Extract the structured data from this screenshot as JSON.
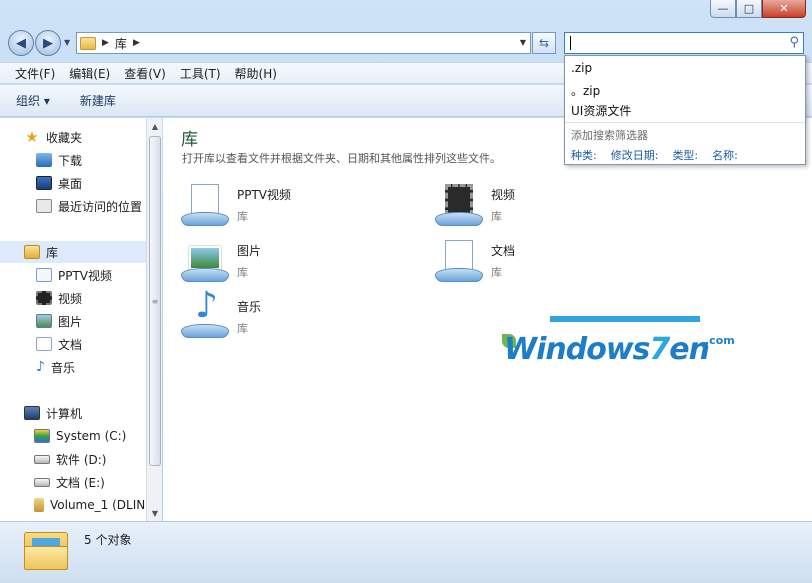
{
  "window": {
    "caption_buttons": [
      "minimize",
      "maximize",
      "close"
    ]
  },
  "address_bar": {
    "crumbs": [
      "库"
    ],
    "search_value": ""
  },
  "search_popup": {
    "history": [
      ".zip",
      "。zip",
      "UI资源文件"
    ],
    "filters_title": "添加搜索筛选器",
    "filters": [
      "种类:",
      "修改日期:",
      "类型:",
      "名称:"
    ]
  },
  "menu": [
    "文件(F)",
    "编辑(E)",
    "查看(V)",
    "工具(T)",
    "帮助(H)"
  ],
  "toolbar": {
    "organize": "组织 ▾",
    "new_library": "新建库"
  },
  "sidebar": {
    "favorites": {
      "label": "收藏夹",
      "items": [
        "下载",
        "桌面",
        "最近访问的位置"
      ]
    },
    "libraries": {
      "label": "库",
      "items": [
        "PPTV视频",
        "视频",
        "图片",
        "文档",
        "音乐"
      ]
    },
    "computer": {
      "label": "计算机",
      "items": [
        "System (C:)",
        "软件 (D:)",
        "文档 (E:)",
        "Volume_1 (DLIN"
      ]
    }
  },
  "main": {
    "title": "库",
    "subtitle": "打开库以查看文件并根据文件夹、日期和其他属性排列这些文件。",
    "libraries": [
      {
        "name": "PPTV视频",
        "kind": "库",
        "icon": "pptv-library-icon"
      },
      {
        "name": "视频",
        "kind": "库",
        "icon": "video-library-icon"
      },
      {
        "name": "图片",
        "kind": "库",
        "icon": "pictures-library-icon"
      },
      {
        "name": "文档",
        "kind": "库",
        "icon": "documents-library-icon"
      },
      {
        "name": "音乐",
        "kind": "库",
        "icon": "music-library-icon"
      }
    ]
  },
  "watermark": {
    "text": "Windows",
    "seven": "7",
    "suffix": "en",
    "domain": ".com"
  },
  "status": {
    "count": "5 个对象"
  },
  "colors": {
    "accent": "#1e5c3a",
    "link": "#1a5aa6",
    "selection": "#dceafc"
  }
}
